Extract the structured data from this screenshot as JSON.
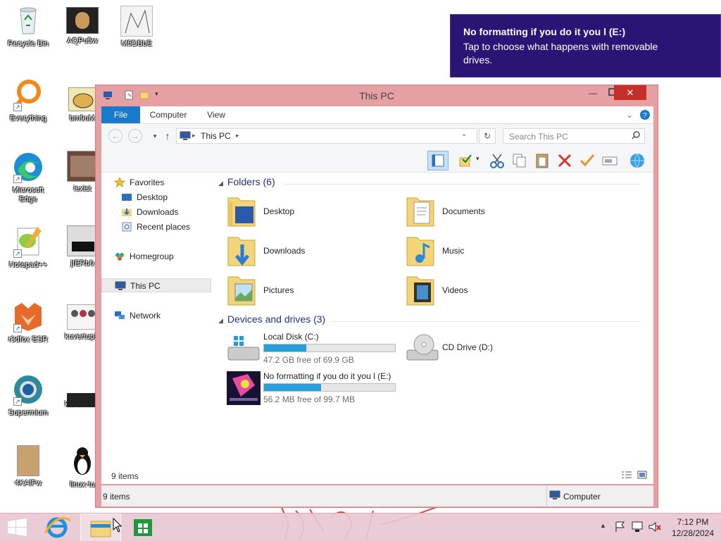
{
  "desktop": {
    "icons": [
      {
        "label": "Recycle Bin",
        "icon": "recycle-bin-icon"
      },
      {
        "label": "AQPu5w",
        "icon": "image-file-icon"
      },
      {
        "label": "M5DBbE",
        "icon": "image-file-icon"
      },
      {
        "label": "Everything",
        "icon": "everything-search-icon"
      },
      {
        "label": "bm9uM",
        "icon": "image-file-icon"
      },
      {
        "label": "Microsoft Edge",
        "icon": "edge-icon"
      },
      {
        "label": "iexist",
        "icon": "image-file-icon"
      },
      {
        "label": "Notepad++",
        "icon": "notepad-plus-plus-icon"
      },
      {
        "label": "jIERb0",
        "icon": "image-file-icon"
      },
      {
        "label": "r3dfox ESR",
        "icon": "r3dfox-icon"
      },
      {
        "label": "kuvertupic",
        "icon": "image-file-icon"
      },
      {
        "label": "Supermium",
        "icon": "supermium-icon"
      },
      {
        "label": "kuvertuwa",
        "icon": "image-file-icon"
      },
      {
        "label": "4KAlFw",
        "icon": "image-file-icon"
      },
      {
        "label": "linux-tu",
        "icon": "linux-tux-icon"
      }
    ]
  },
  "toast": {
    "title": "No formatting if you do it you l (E:)",
    "message": "Tap to choose what happens with removable drives."
  },
  "window": {
    "title": "This PC",
    "ribbon_tabs": [
      "File",
      "Computer",
      "View"
    ],
    "address": {
      "location": "This PC"
    },
    "search": {
      "placeholder": "Search This PC"
    },
    "nav": {
      "favorites": "Favorites",
      "desktop": "Desktop",
      "downloads": "Downloads",
      "recent": "Recent places",
      "homegroup": "Homegroup",
      "thispc": "This PC",
      "network": "Network"
    },
    "folders_header": "Folders (6)",
    "folders": [
      "Desktop",
      "Documents",
      "Downloads",
      "Music",
      "Pictures",
      "Videos"
    ],
    "drives_header": "Devices and drives (3)",
    "drives": [
      {
        "name": "Local Disk (C:)",
        "free": "47.2 GB free of 69.9 GB",
        "used_fraction": 0.325
      },
      {
        "name": "CD Drive (D:)"
      },
      {
        "name": "No formatting if you do it you l (E:)",
        "free": "56.2 MB free of 99.7 MB",
        "used_fraction": 0.436
      }
    ],
    "items_count_inner": "9 items",
    "status_left": "9 items",
    "status_right": "Computer"
  },
  "taskbar": {
    "time": "7:12 PM",
    "date": "12/28/2024"
  },
  "colors": {
    "accent": "#1979ca",
    "window_frame": "#e6a0a3",
    "toast_bg": "#2a1474",
    "close_button": "#c7302a",
    "progress": "#26a0da"
  }
}
